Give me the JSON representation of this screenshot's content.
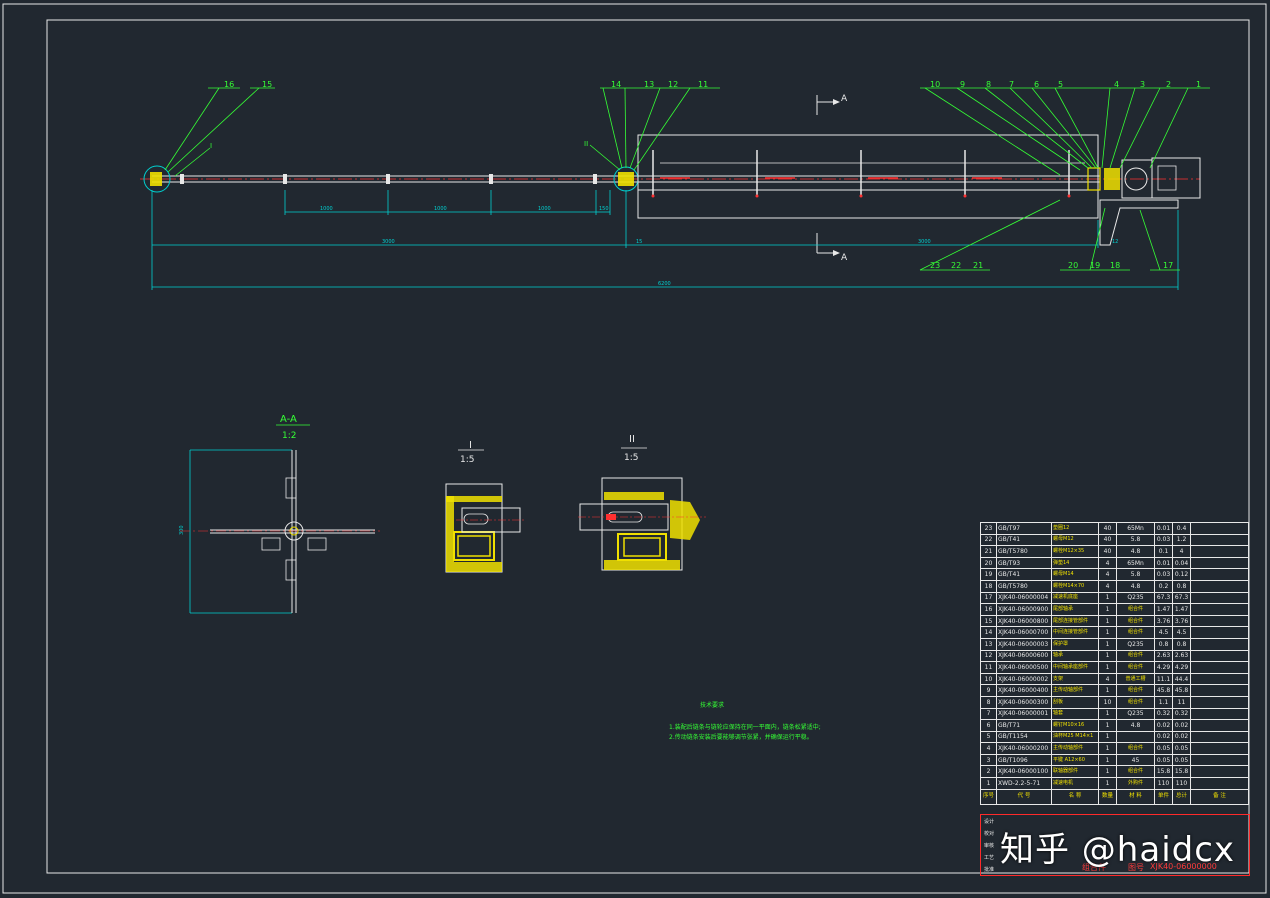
{
  "balloons_top": [
    "16",
    "15",
    "14",
    "13",
    "12",
    "11",
    "10",
    "9",
    "8",
    "7",
    "6",
    "5",
    "4",
    "3",
    "2",
    "1"
  ],
  "balloons_bottom": [
    "23",
    "22",
    "21",
    "20",
    "19",
    "18",
    "17"
  ],
  "section_marker": "A",
  "detail_labels": {
    "I": "I",
    "II": "II"
  },
  "dimensions": {
    "span1": "1000",
    "span2": "1000",
    "span3": "1000",
    "span4": "150",
    "left_total": "3000",
    "right_total": "3000",
    "overall": "6200",
    "left_gap": "15",
    "right_gap": "12"
  },
  "views": {
    "aa_title": "A-A",
    "aa_scale": "1:2",
    "aa_height": "300",
    "i_title": "I",
    "i_scale": "1:5",
    "ii_title": "II",
    "ii_scale": "1:5"
  },
  "tech_title": "技术要求",
  "tech_lines": [
    "1.装配后链条与链轮应保持在同一平面内，链条松紧适中;",
    "2.传动链条安装后要能够调节张紧，并确保运行平稳。"
  ],
  "bom": {
    "header": [
      "序号",
      "代 号",
      "名 称",
      "数量",
      "材 料",
      "单件",
      "总计",
      "备 注"
    ],
    "rows": [
      [
        "23",
        "GB/T97",
        "垫圈12",
        "40",
        "65Mn",
        "0.01",
        "0.4"
      ],
      [
        "22",
        "GB/T41",
        "螺母M12",
        "40",
        "5.8",
        "0.03",
        "1.2"
      ],
      [
        "21",
        "GB/T5780",
        "螺栓M12×35",
        "40",
        "4.8",
        "0.1",
        "4"
      ],
      [
        "20",
        "GB/T93",
        "弹垫14",
        "4",
        "65Mn",
        "0.01",
        "0.04"
      ],
      [
        "19",
        "GB/T41",
        "螺母M14",
        "4",
        "5.8",
        "0.03",
        "0.12"
      ],
      [
        "18",
        "GB/T5780",
        "螺栓M14×70",
        "4",
        "4.8",
        "0.2",
        "0.8"
      ],
      [
        "17",
        "XJK40-06000004",
        "减速机底座",
        "1",
        "Q235",
        "67.3",
        "67.3"
      ],
      [
        "16",
        "XJK40-06000900",
        "尾部轴承",
        "1",
        "组合件",
        "1.47",
        "1.47"
      ],
      [
        "15",
        "XJK40-06000800",
        "尾部连接管部件",
        "1",
        "组合件",
        "3.76",
        "3.76"
      ],
      [
        "14",
        "XJK40-06000700",
        "中间连接管部件",
        "1",
        "组合件",
        "4.5",
        "4.5"
      ],
      [
        "13",
        "XJK40-06000003",
        "保护罩",
        "1",
        "Q235",
        "0.8",
        "0.8"
      ],
      [
        "12",
        "XJK40-06000600",
        "轴承",
        "1",
        "组合件",
        "2.63",
        "2.63"
      ],
      [
        "11",
        "XJK40-06000500",
        "中间轴承座部件",
        "1",
        "组合件",
        "4.29",
        "4.29"
      ],
      [
        "10",
        "XJK40-06000002",
        "支架",
        "4",
        "普通工槽",
        "11.1",
        "44.4"
      ],
      [
        "9",
        "XJK40-06000400",
        "主传动轴部件",
        "1",
        "组合件",
        "45.8",
        "45.8"
      ],
      [
        "8",
        "XJK40-06000300",
        "刮板",
        "10",
        "组合件",
        "1.1",
        "11"
      ],
      [
        "7",
        "XJK40-06000001",
        "轴套",
        "1",
        "Q235",
        "0.32",
        "0.32"
      ],
      [
        "6",
        "GB/T71",
        "螺钉M10×16",
        "1",
        "4.8",
        "0.02",
        "0.02"
      ],
      [
        "5",
        "GB/T1154",
        "油杯M25 M14×1",
        "1",
        "",
        "0.02",
        "0.02"
      ],
      [
        "4",
        "XJK40-06000200",
        "主传动轴部件",
        "1",
        "组合件",
        "0.05",
        "0.05"
      ],
      [
        "3",
        "GB/T1096",
        "平键 A12×60",
        "1",
        "45",
        "0.05",
        "0.05"
      ],
      [
        "2",
        "XJK40-06000100",
        "联轴器部件",
        "1",
        "组合件",
        "15.8",
        "15.8"
      ],
      [
        "1",
        "XWD-2.2-5-71",
        "减速电机",
        "1",
        "外购件",
        "110",
        "110"
      ]
    ]
  },
  "title_block": {
    "row_labels": [
      "设计",
      "校对",
      "审核",
      "工艺",
      "批准"
    ],
    "assembly": "组合件",
    "drawing_no_label": "图号",
    "drawing_no": "XJK40-06000000"
  },
  "watermark": "知乎 @haidcx",
  "colors": {
    "bg": "#212830",
    "frame": "#e8e8e8",
    "dim": "#00d0d0",
    "balloon": "#35ff35",
    "part": "#f0e000",
    "centerline": "#ff3030"
  }
}
